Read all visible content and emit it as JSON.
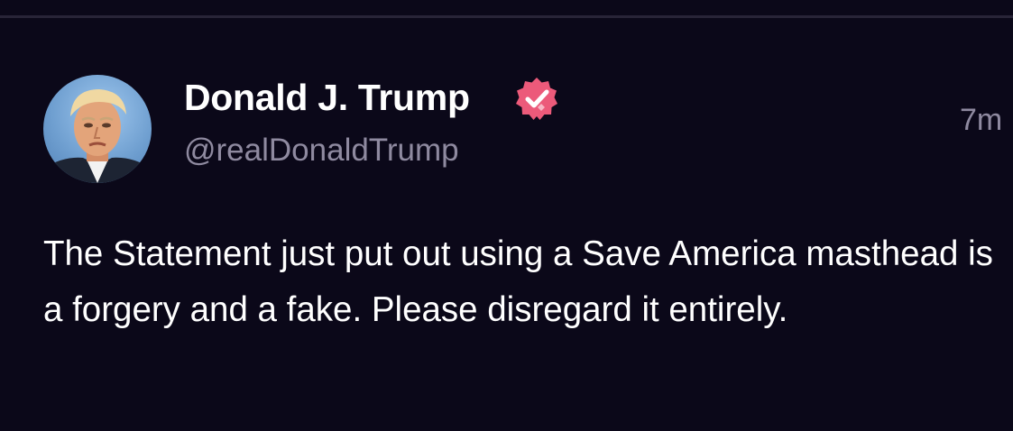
{
  "post": {
    "author": {
      "display_name": "Donald J. Trump",
      "handle": "@realDonaldTrump",
      "verified": true,
      "avatar_icon": "profile-photo"
    },
    "timestamp": "7m",
    "body": "The Statement just put out using a Save America masthead is a forgery and a fake. Please disregard it entirely."
  },
  "colors": {
    "background": "#0b0819",
    "divider": "#282437",
    "text_primary": "#ffffff",
    "text_secondary": "#8f8aa0",
    "verified_badge": "#ec5a7a"
  }
}
